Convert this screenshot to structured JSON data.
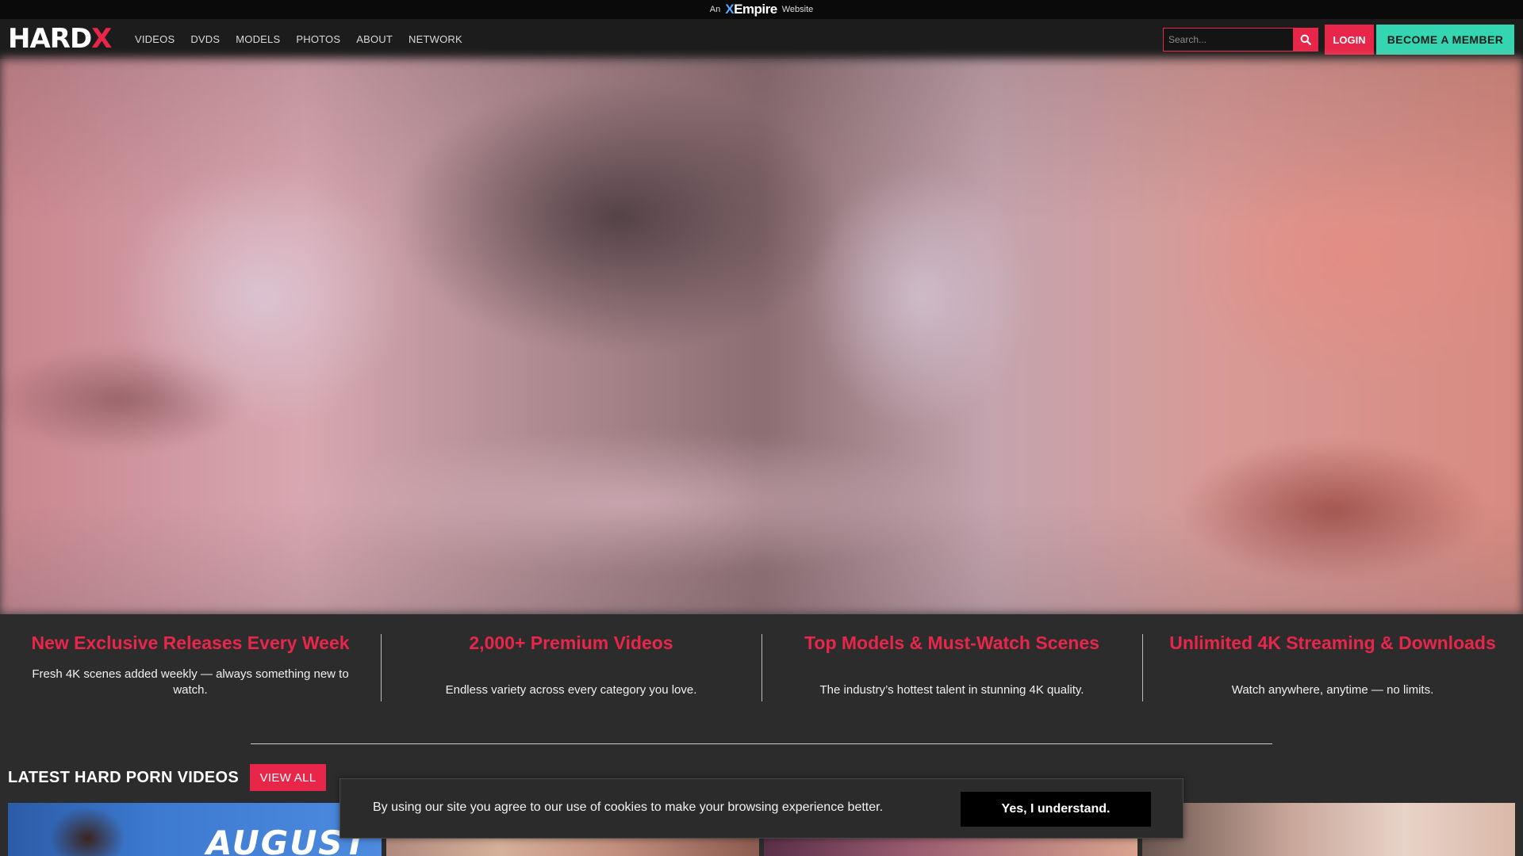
{
  "top_strip": {
    "prefix": "An",
    "brand_x": "X",
    "brand_rest": "Empire",
    "suffix": "Website"
  },
  "header": {
    "logo_main": "HARD",
    "logo_accent": "X",
    "nav": [
      "VIDEOS",
      "DVDS",
      "MODELS",
      "PHOTOS",
      "ABOUT",
      "NETWORK"
    ],
    "search_placeholder": "Search...",
    "search_icon": "search-icon",
    "login_label": "LOGIN",
    "member_label": "BECOME A MEMBER"
  },
  "colors": {
    "accent": "#e8264a",
    "member": "#33d6b1",
    "background": "#2c2c2d"
  },
  "features": [
    {
      "title": "New Exclusive Releases Every Week",
      "text": "Fresh 4K scenes added weekly — always something new to watch."
    },
    {
      "title": "2,000+ Premium Videos",
      "text": "Endless variety across every category you love."
    },
    {
      "title": "Top Models & Must-Watch Scenes",
      "text": "The industry’s hottest talent in stunning 4K quality."
    },
    {
      "title": "Unlimited 4K Streaming & Downloads",
      "text": "Watch anywhere, anytime — no limits."
    }
  ],
  "latest": {
    "title": "LATEST HARD PORN VIDEOS",
    "view_all": "VIEW ALL",
    "thumb1_text": "AUGUST"
  },
  "cookie": {
    "text": "By using our site you agree to our use of cookies to make your browsing experience better.",
    "button": "Yes, I understand."
  }
}
